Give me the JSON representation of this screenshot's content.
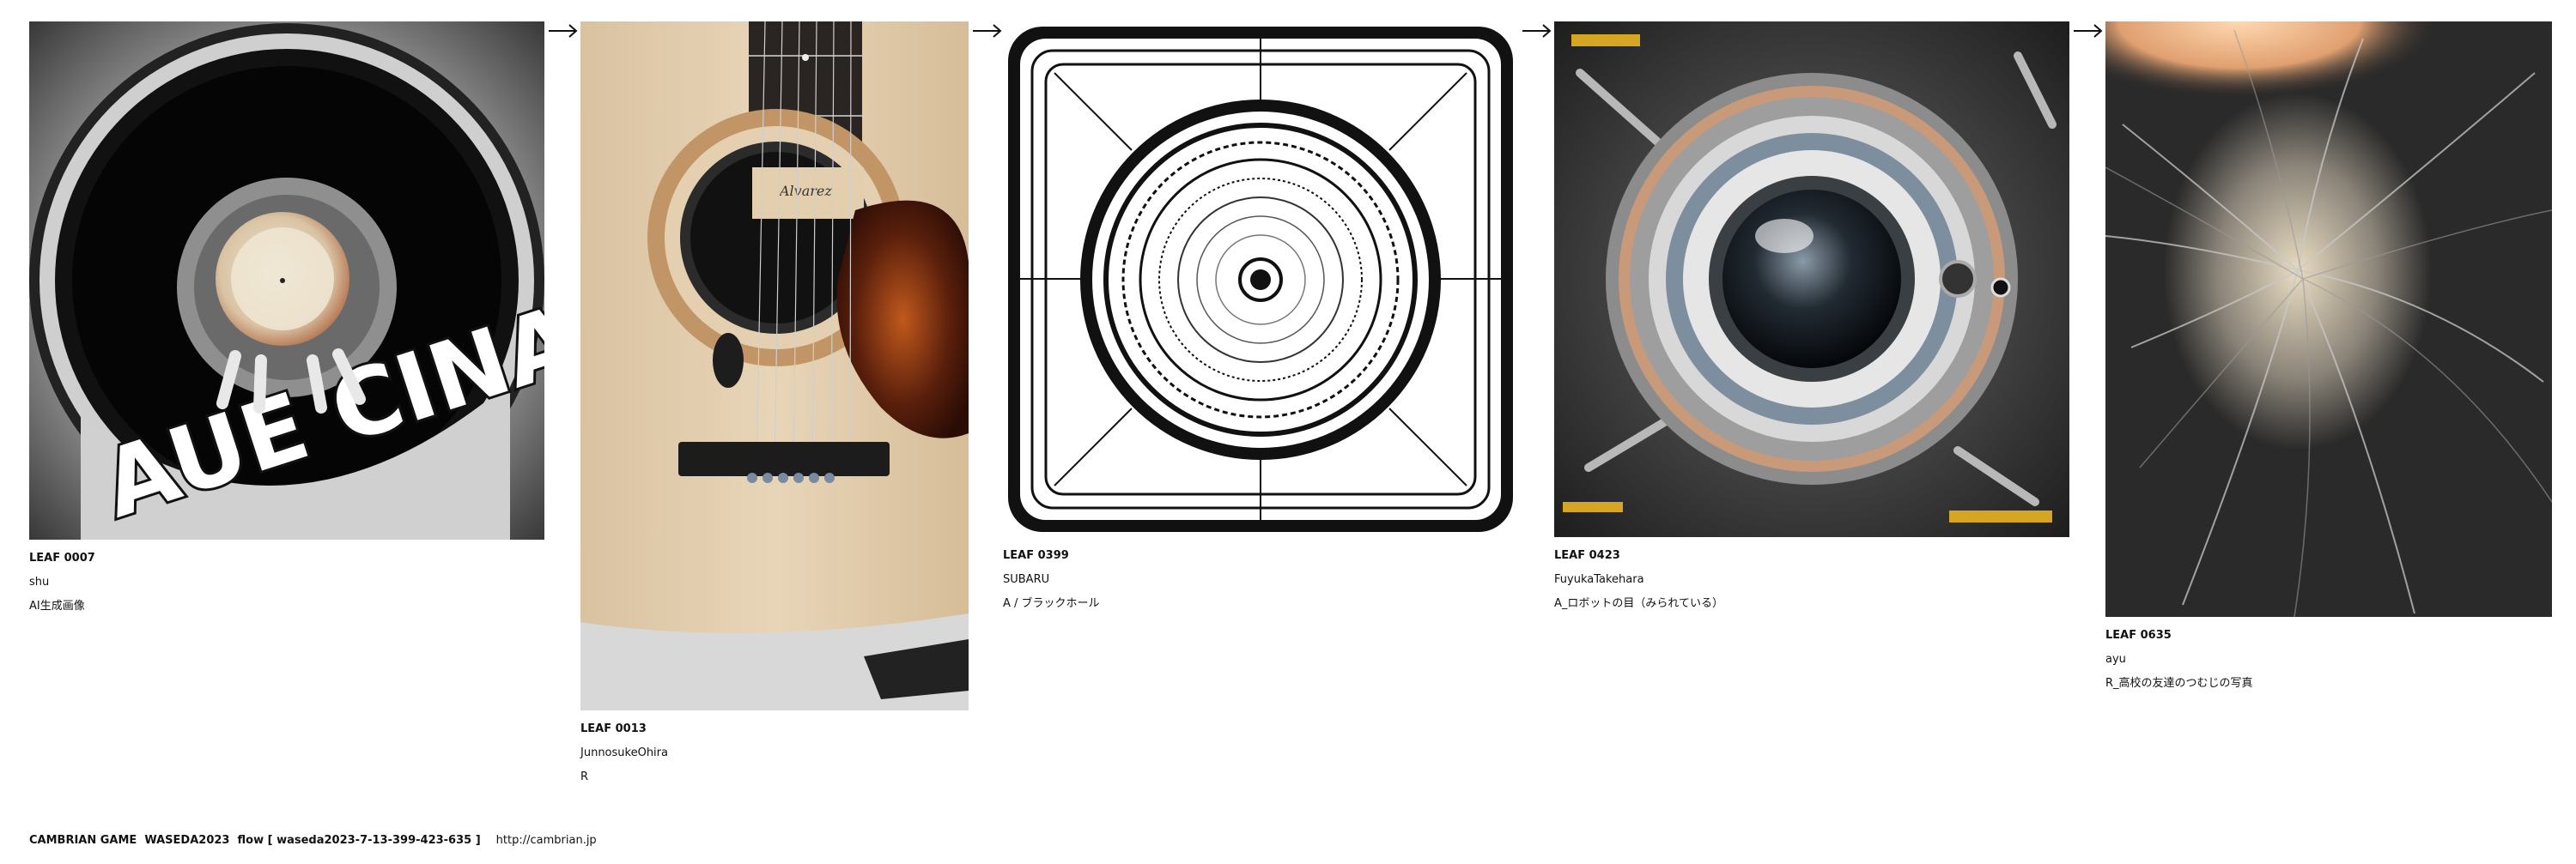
{
  "leaves": [
    {
      "id": "LEAF 0007",
      "author": "shu",
      "caption": "AI生成画像"
    },
    {
      "id": "LEAF 0013",
      "author": "JunnosukeOhira",
      "caption": "R"
    },
    {
      "id": "LEAF 0399",
      "author": "SUBARU",
      "caption": "A / ブラックホール"
    },
    {
      "id": "LEAF 0423",
      "author": "FuyukaTakehara",
      "caption": "A_ロボットの目（みられている）"
    },
    {
      "id": "LEAF 0635",
      "author": "ayu",
      "caption": "R_高校の友達のつむじの写真"
    }
  ],
  "images": {
    "leaf_0007": "AUE CINAC",
    "leaf_0013": "Alvarez"
  },
  "icons": [
    "arrow-right-icon"
  ],
  "footer": {
    "text": "CAMBRIAN GAME  WASEDA2023  flow [ waseda2023-7-13-399-423-635 ]",
    "url": "http://cambrian.jp"
  }
}
